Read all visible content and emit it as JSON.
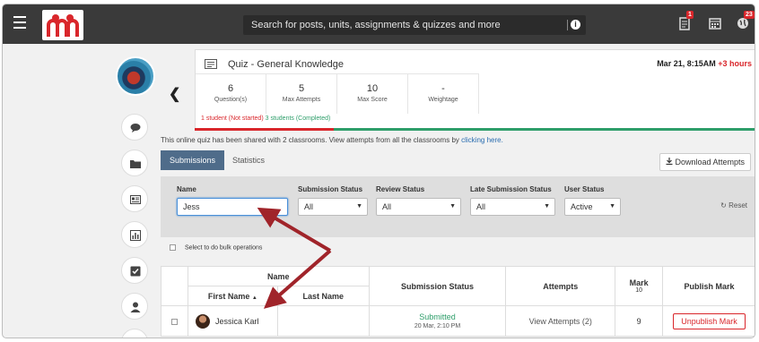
{
  "topbar": {
    "search_placeholder": "Search for posts, units, assignments & quizzes and more",
    "info_glyph": "i",
    "notif_badge": "1",
    "globe_badge": "23"
  },
  "quiz": {
    "title": "Quiz - General Knowledge",
    "date": "Mar 21, 8:15AM",
    "date_extra": "+3 hours",
    "stats": [
      {
        "value": "6",
        "label": "Question(s)"
      },
      {
        "value": "5",
        "label": "Max Attempts"
      },
      {
        "value": "10",
        "label": "Max Score"
      },
      {
        "value": "-",
        "label": "Weightage"
      }
    ],
    "counts_red": "1 student (Not started)",
    "counts_green": "3 students (Completed)"
  },
  "shared": {
    "text": "This online quiz has been shared with 2 classrooms. View attempts from all the classrooms by",
    "link": "clicking here."
  },
  "tabs": [
    {
      "label": "Submissions"
    },
    {
      "label": "Statistics"
    }
  ],
  "download_label": "Download Attempts",
  "filters": {
    "name_label": "Name",
    "name_value": "Jess",
    "submission_label": "Submission Status",
    "submission_value": "All",
    "review_label": "Review Status",
    "review_value": "All",
    "late_label": "Late Submission Status",
    "late_value": "All",
    "user_label": "User Status",
    "user_value": "Active",
    "reset_label": "Reset"
  },
  "bulk_label": "Select to do bulk operations",
  "table": {
    "h_name": "Name",
    "h_first": "First Name",
    "h_last": "Last Name",
    "h_status": "Submission Status",
    "h_attempts": "Attempts",
    "h_mark": "Mark",
    "h_mark_max": "10",
    "h_publish": "Publish Mark",
    "rows": [
      {
        "first_name": "Jessica Karl",
        "last_name": "",
        "status": "Submitted",
        "date": "20 Mar, 2:10 PM",
        "attempts": "View Attempts (2)",
        "mark": "9",
        "publish": "Unpublish Mark"
      }
    ]
  },
  "colors": {
    "topbar": "#3a3a3a",
    "accent_red": "#d9262b",
    "accent_green": "#2e9e6a",
    "tab_active": "#4f6c8a",
    "arrow": "#a0242a"
  }
}
